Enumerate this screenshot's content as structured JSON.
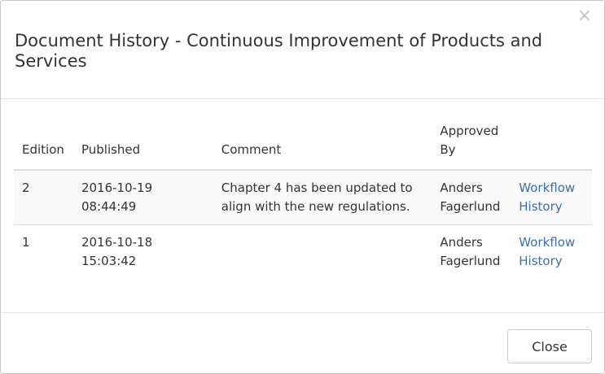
{
  "dialog": {
    "title": "Document History - Continuous Improvement of Products and Services",
    "close_icon_glyph": "×"
  },
  "table": {
    "headers": {
      "edition": "Edition",
      "published": "Published",
      "comment": "Comment",
      "approved_by": "Approved By"
    },
    "rows": [
      {
        "edition": "2",
        "published": "2016-10-19 08:44:49",
        "comment": "Chapter 4 has been updated to align with the new regulations.",
        "approved_by": "Anders Fagerlund",
        "link": "Workflow History"
      },
      {
        "edition": "1",
        "published": "2016-10-18 15:03:42",
        "comment": "",
        "approved_by": "Anders Fagerlund",
        "link": "Workflow History"
      }
    ]
  },
  "footer": {
    "close_label": "Close"
  },
  "colors": {
    "link": "#3a6fb0",
    "text": "#333333",
    "stripe": "#f9f9f9",
    "border": "#dddddd",
    "close_icon": "#c4c4c4"
  }
}
